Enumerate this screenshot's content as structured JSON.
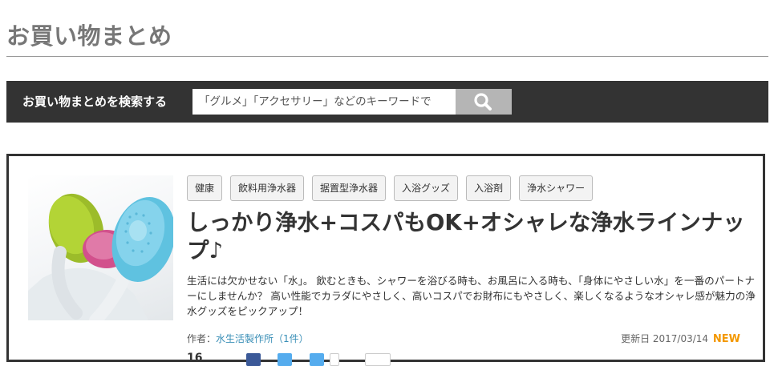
{
  "site": {
    "title": "お買い物まとめ"
  },
  "search": {
    "label": "お買い物まとめを検索する",
    "placeholder": "「グルメ」「アクセサリー」などのキーワードで",
    "button_icon": "search-icon"
  },
  "article": {
    "tags": [
      "健康",
      "飲料用浄水器",
      "据置型浄水器",
      "入浴グッズ",
      "入浴剤",
      "浄水シャワー"
    ],
    "title": "しっかり浄水+コスパもOK+オシャレな浄水ラインナップ♪",
    "description": "生活には欠かせない「水」。 飲むときも、シャワーを浴びる時も、お風呂に入る時も、「身体にやさしい水」を一番のパートナーにしませんか？ 高い性能でカラダにやさしく、高いコスパでお財布にもやさしく、楽しくなるようなオシャレ感が魅力の浄水グッズをピックアップ！",
    "author_label": "作者：",
    "author_name": "水生活製作所（1件）",
    "updated_label": "更新日 2017/03/14",
    "new_badge": "NEW",
    "share_count": "16",
    "share_icons": [
      "facebook-icon",
      "twitter-icon",
      "twitter-icon",
      "bookmark-icon",
      "bookmark-icon"
    ],
    "colors": {
      "facebook": "#3b5998",
      "twitter": "#55acee",
      "new": "#f39800",
      "link": "#3a8fb7"
    }
  }
}
